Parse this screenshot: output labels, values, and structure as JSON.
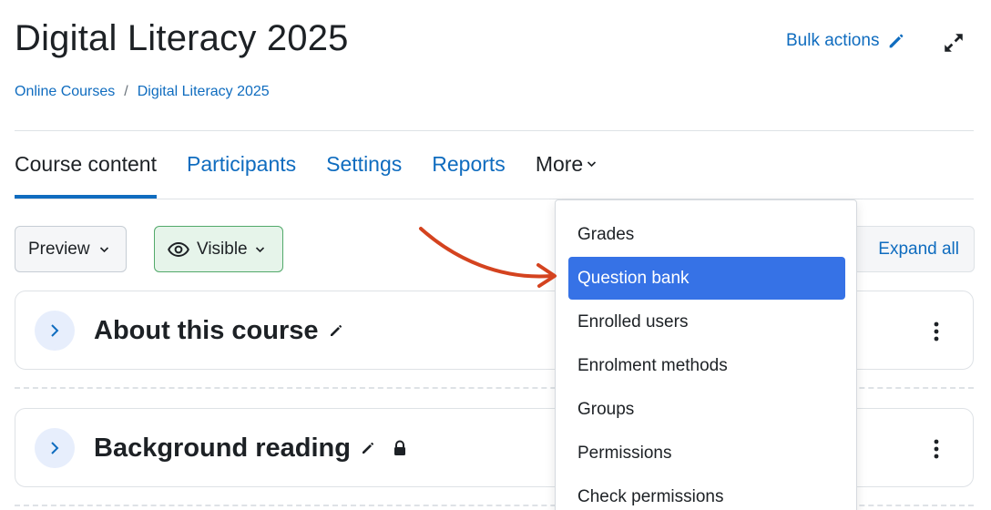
{
  "header": {
    "title": "Digital Literacy 2025",
    "bulk_actions_label": "Bulk actions"
  },
  "breadcrumb": {
    "items": [
      "Online Courses",
      "Digital Literacy 2025"
    ],
    "separator": "/"
  },
  "tabs": [
    {
      "label": "Course content",
      "active": true
    },
    {
      "label": "Participants"
    },
    {
      "label": "Settings"
    },
    {
      "label": "Reports"
    },
    {
      "label": "More"
    }
  ],
  "toolbar": {
    "preview_label": "Preview",
    "visible_label": "Visible",
    "expand_all_label": "Expand all"
  },
  "sections": [
    {
      "title": "About this course",
      "locked": false
    },
    {
      "title": "Background reading",
      "locked": true
    }
  ],
  "more_menu": {
    "items": [
      {
        "label": "Grades"
      },
      {
        "label": "Question bank",
        "highlighted": true
      },
      {
        "label": "Enrolled users"
      },
      {
        "label": "Enrolment methods"
      },
      {
        "label": "Groups"
      },
      {
        "label": "Permissions"
      },
      {
        "label": "Check permissions"
      }
    ]
  },
  "colors": {
    "link": "#0f6cbf",
    "highlight": "#3672e6",
    "annotation_arrow": "#d4431f",
    "visible_bg": "#e6f4ea",
    "visible_border": "#52a96a"
  },
  "icons": [
    "pencil-icon",
    "expand-icon",
    "chevron-down-icon",
    "eye-icon",
    "chevron-right-icon",
    "kebab-menu-icon",
    "lock-icon"
  ]
}
